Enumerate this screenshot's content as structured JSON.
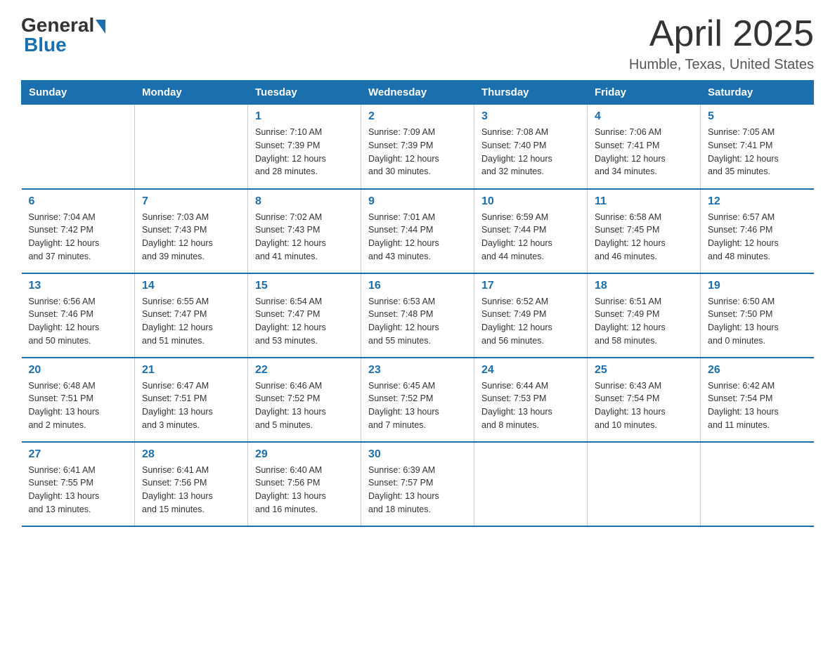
{
  "logo": {
    "general": "General",
    "blue": "Blue"
  },
  "title": "April 2025",
  "location": "Humble, Texas, United States",
  "days_of_week": [
    "Sunday",
    "Monday",
    "Tuesday",
    "Wednesday",
    "Thursday",
    "Friday",
    "Saturday"
  ],
  "weeks": [
    [
      {
        "day": "",
        "info": ""
      },
      {
        "day": "",
        "info": ""
      },
      {
        "day": "1",
        "info": "Sunrise: 7:10 AM\nSunset: 7:39 PM\nDaylight: 12 hours\nand 28 minutes."
      },
      {
        "day": "2",
        "info": "Sunrise: 7:09 AM\nSunset: 7:39 PM\nDaylight: 12 hours\nand 30 minutes."
      },
      {
        "day": "3",
        "info": "Sunrise: 7:08 AM\nSunset: 7:40 PM\nDaylight: 12 hours\nand 32 minutes."
      },
      {
        "day": "4",
        "info": "Sunrise: 7:06 AM\nSunset: 7:41 PM\nDaylight: 12 hours\nand 34 minutes."
      },
      {
        "day": "5",
        "info": "Sunrise: 7:05 AM\nSunset: 7:41 PM\nDaylight: 12 hours\nand 35 minutes."
      }
    ],
    [
      {
        "day": "6",
        "info": "Sunrise: 7:04 AM\nSunset: 7:42 PM\nDaylight: 12 hours\nand 37 minutes."
      },
      {
        "day": "7",
        "info": "Sunrise: 7:03 AM\nSunset: 7:43 PM\nDaylight: 12 hours\nand 39 minutes."
      },
      {
        "day": "8",
        "info": "Sunrise: 7:02 AM\nSunset: 7:43 PM\nDaylight: 12 hours\nand 41 minutes."
      },
      {
        "day": "9",
        "info": "Sunrise: 7:01 AM\nSunset: 7:44 PM\nDaylight: 12 hours\nand 43 minutes."
      },
      {
        "day": "10",
        "info": "Sunrise: 6:59 AM\nSunset: 7:44 PM\nDaylight: 12 hours\nand 44 minutes."
      },
      {
        "day": "11",
        "info": "Sunrise: 6:58 AM\nSunset: 7:45 PM\nDaylight: 12 hours\nand 46 minutes."
      },
      {
        "day": "12",
        "info": "Sunrise: 6:57 AM\nSunset: 7:46 PM\nDaylight: 12 hours\nand 48 minutes."
      }
    ],
    [
      {
        "day": "13",
        "info": "Sunrise: 6:56 AM\nSunset: 7:46 PM\nDaylight: 12 hours\nand 50 minutes."
      },
      {
        "day": "14",
        "info": "Sunrise: 6:55 AM\nSunset: 7:47 PM\nDaylight: 12 hours\nand 51 minutes."
      },
      {
        "day": "15",
        "info": "Sunrise: 6:54 AM\nSunset: 7:47 PM\nDaylight: 12 hours\nand 53 minutes."
      },
      {
        "day": "16",
        "info": "Sunrise: 6:53 AM\nSunset: 7:48 PM\nDaylight: 12 hours\nand 55 minutes."
      },
      {
        "day": "17",
        "info": "Sunrise: 6:52 AM\nSunset: 7:49 PM\nDaylight: 12 hours\nand 56 minutes."
      },
      {
        "day": "18",
        "info": "Sunrise: 6:51 AM\nSunset: 7:49 PM\nDaylight: 12 hours\nand 58 minutes."
      },
      {
        "day": "19",
        "info": "Sunrise: 6:50 AM\nSunset: 7:50 PM\nDaylight: 13 hours\nand 0 minutes."
      }
    ],
    [
      {
        "day": "20",
        "info": "Sunrise: 6:48 AM\nSunset: 7:51 PM\nDaylight: 13 hours\nand 2 minutes."
      },
      {
        "day": "21",
        "info": "Sunrise: 6:47 AM\nSunset: 7:51 PM\nDaylight: 13 hours\nand 3 minutes."
      },
      {
        "day": "22",
        "info": "Sunrise: 6:46 AM\nSunset: 7:52 PM\nDaylight: 13 hours\nand 5 minutes."
      },
      {
        "day": "23",
        "info": "Sunrise: 6:45 AM\nSunset: 7:52 PM\nDaylight: 13 hours\nand 7 minutes."
      },
      {
        "day": "24",
        "info": "Sunrise: 6:44 AM\nSunset: 7:53 PM\nDaylight: 13 hours\nand 8 minutes."
      },
      {
        "day": "25",
        "info": "Sunrise: 6:43 AM\nSunset: 7:54 PM\nDaylight: 13 hours\nand 10 minutes."
      },
      {
        "day": "26",
        "info": "Sunrise: 6:42 AM\nSunset: 7:54 PM\nDaylight: 13 hours\nand 11 minutes."
      }
    ],
    [
      {
        "day": "27",
        "info": "Sunrise: 6:41 AM\nSunset: 7:55 PM\nDaylight: 13 hours\nand 13 minutes."
      },
      {
        "day": "28",
        "info": "Sunrise: 6:41 AM\nSunset: 7:56 PM\nDaylight: 13 hours\nand 15 minutes."
      },
      {
        "day": "29",
        "info": "Sunrise: 6:40 AM\nSunset: 7:56 PM\nDaylight: 13 hours\nand 16 minutes."
      },
      {
        "day": "30",
        "info": "Sunrise: 6:39 AM\nSunset: 7:57 PM\nDaylight: 13 hours\nand 18 minutes."
      },
      {
        "day": "",
        "info": ""
      },
      {
        "day": "",
        "info": ""
      },
      {
        "day": "",
        "info": ""
      }
    ]
  ]
}
